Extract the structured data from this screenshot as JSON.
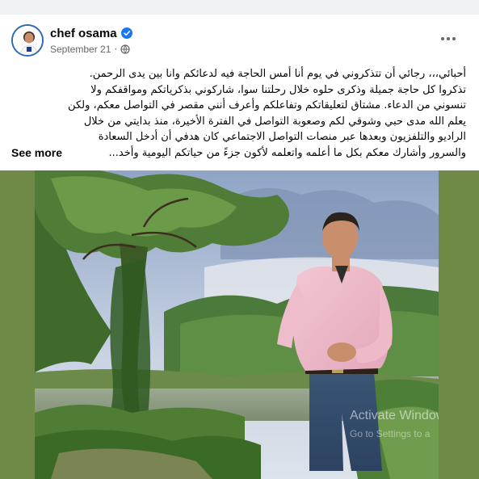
{
  "post": {
    "author": "chef osama",
    "date": "September 21",
    "date_separator": "·",
    "verified_icon": "verified-badge-icon",
    "privacy_icon": "globe-icon",
    "options_icon": "more-options-icon"
  },
  "body": {
    "lines": [
      "أحبائي،،، رجائي أن تتذكروني في يوم أنا أمس الحاجة فيه لدعائكم وانا بين يدى الرحمن.",
      "تذكروا كل حاجة جميلة وذكرى حلوه خلال رحلتنا سوا، شاركوني بذكرياتكم ومواقفكم ولا",
      "تنسوني من الدعاء.  مشتاق لتعليقاتكم وتفاعلكم وأعرف أنني مقصر في التواصل معكم، ولكن",
      "يعلم الله مدى حبي وشوقي لكم وصعوبة التواصل في الفترة الأخيرة، منذ بدايتي من خلال",
      "الراديو والتلفزيون وبعدها عبر منصات التواصل الاجتماعي كان هدفي أن أدخل السعادة"
    ],
    "last_line": "والسرور وأشارك معكم بكل ما أعلمه واتعلمه لأكون جزءً من حياتكم اليومية وأخد...",
    "see_more": "See more"
  },
  "photo": {
    "watermark_line1": "Activate Windows",
    "watermark_line2": "Go to Settings to a",
    "border_color": "#6f8a47"
  }
}
